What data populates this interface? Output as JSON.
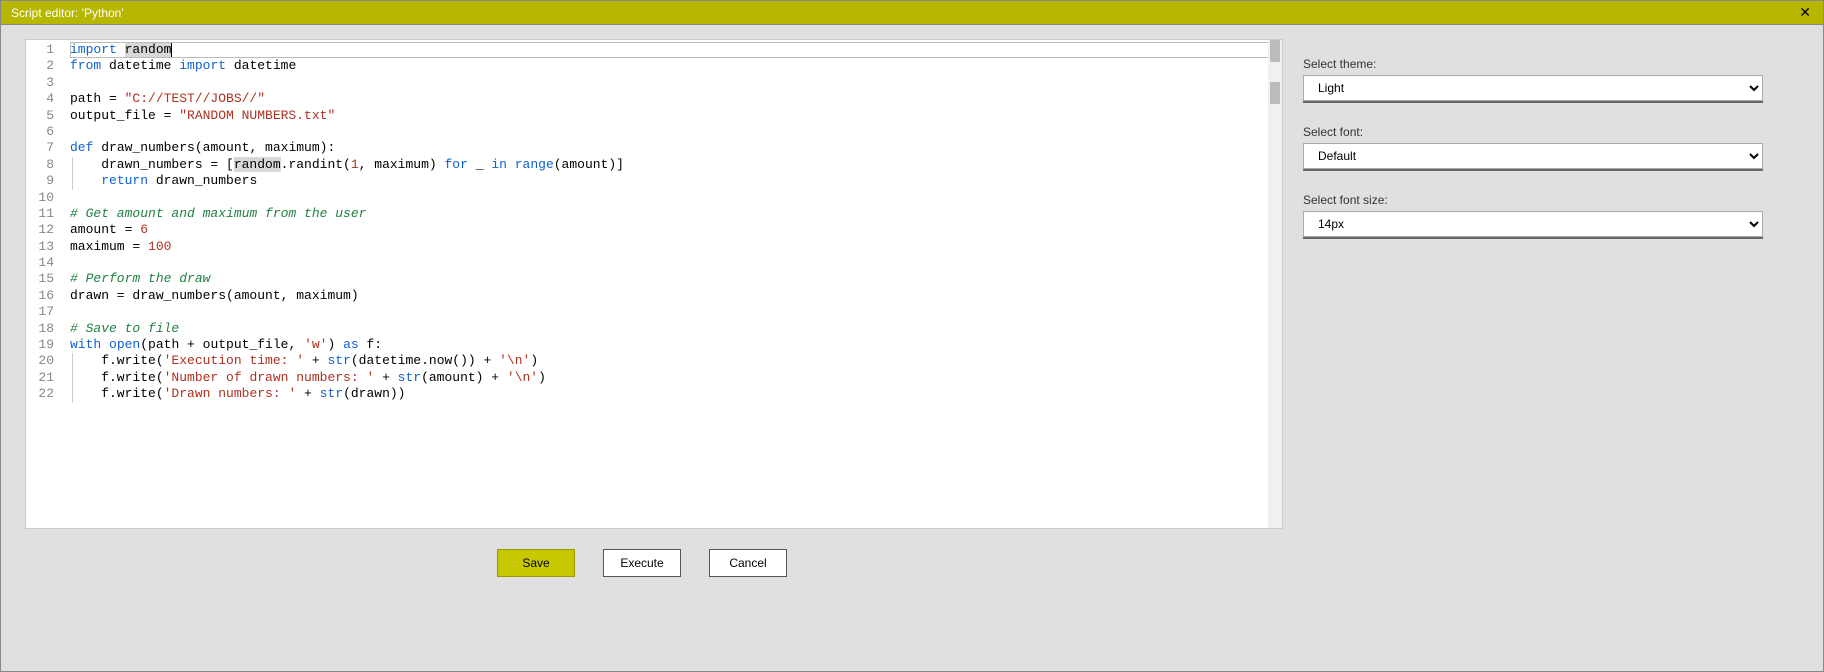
{
  "title": "Script editor: 'Python'",
  "code_lines": [
    {
      "n": 1,
      "tokens": [
        {
          "t": "import ",
          "c": "kw"
        },
        {
          "t": "random",
          "c": "hl"
        }
      ],
      "active": true
    },
    {
      "n": 2,
      "tokens": [
        {
          "t": "from ",
          "c": "kw"
        },
        {
          "t": "datetime ",
          "c": ""
        },
        {
          "t": "import ",
          "c": "kw"
        },
        {
          "t": "datetime",
          "c": ""
        }
      ]
    },
    {
      "n": 3,
      "tokens": []
    },
    {
      "n": 4,
      "tokens": [
        {
          "t": "path = ",
          "c": ""
        },
        {
          "t": "\"C://TEST//JOBS//\"",
          "c": "str"
        }
      ]
    },
    {
      "n": 5,
      "tokens": [
        {
          "t": "output_file = ",
          "c": ""
        },
        {
          "t": "\"RANDOM NUMBERS.txt\"",
          "c": "str"
        }
      ]
    },
    {
      "n": 6,
      "tokens": []
    },
    {
      "n": 7,
      "tokens": [
        {
          "t": "def ",
          "c": "def"
        },
        {
          "t": "draw_numbers",
          "c": "fn"
        },
        {
          "t": "(amount, maximum):",
          "c": ""
        }
      ]
    },
    {
      "n": 8,
      "indent": 1,
      "tokens": [
        {
          "t": "    drawn_numbers = [",
          "c": ""
        },
        {
          "t": "random",
          "c": "hl"
        },
        {
          "t": ".randint(",
          "c": ""
        },
        {
          "t": "1",
          "c": "num"
        },
        {
          "t": ", maximum) ",
          "c": ""
        },
        {
          "t": "for ",
          "c": "kw"
        },
        {
          "t": "_ ",
          "c": ""
        },
        {
          "t": "in ",
          "c": "kw"
        },
        {
          "t": "range",
          "c": "builtin"
        },
        {
          "t": "(amount)]",
          "c": ""
        }
      ]
    },
    {
      "n": 9,
      "indent": 1,
      "tokens": [
        {
          "t": "    ",
          "c": ""
        },
        {
          "t": "return ",
          "c": "kw"
        },
        {
          "t": "drawn_numbers",
          "c": ""
        }
      ]
    },
    {
      "n": 10,
      "tokens": []
    },
    {
      "n": 11,
      "tokens": [
        {
          "t": "# Get amount and maximum from the user",
          "c": "cmt"
        }
      ]
    },
    {
      "n": 12,
      "tokens": [
        {
          "t": "amount = ",
          "c": ""
        },
        {
          "t": "6",
          "c": "num"
        }
      ]
    },
    {
      "n": 13,
      "tokens": [
        {
          "t": "maximum = ",
          "c": ""
        },
        {
          "t": "100",
          "c": "num"
        }
      ]
    },
    {
      "n": 14,
      "tokens": []
    },
    {
      "n": 15,
      "tokens": [
        {
          "t": "# Perform the draw",
          "c": "cmt"
        }
      ]
    },
    {
      "n": 16,
      "tokens": [
        {
          "t": "drawn = draw_numbers(amount, maximum)",
          "c": ""
        }
      ]
    },
    {
      "n": 17,
      "tokens": []
    },
    {
      "n": 18,
      "tokens": [
        {
          "t": "# Save to file",
          "c": "cmt"
        }
      ]
    },
    {
      "n": 19,
      "tokens": [
        {
          "t": "with ",
          "c": "kw"
        },
        {
          "t": "open",
          "c": "builtin"
        },
        {
          "t": "(path + output_file, ",
          "c": ""
        },
        {
          "t": "'w'",
          "c": "str"
        },
        {
          "t": ") ",
          "c": ""
        },
        {
          "t": "as ",
          "c": "kw"
        },
        {
          "t": "f:",
          "c": ""
        }
      ]
    },
    {
      "n": 20,
      "indent": 1,
      "tokens": [
        {
          "t": "    f.write(",
          "c": ""
        },
        {
          "t": "'Execution time: '",
          "c": "str"
        },
        {
          "t": " + ",
          "c": ""
        },
        {
          "t": "str",
          "c": "builtin"
        },
        {
          "t": "(datetime.now()) + ",
          "c": ""
        },
        {
          "t": "'\\n'",
          "c": "str"
        },
        {
          "t": ")",
          "c": ""
        }
      ]
    },
    {
      "n": 21,
      "indent": 1,
      "tokens": [
        {
          "t": "    f.write(",
          "c": ""
        },
        {
          "t": "'Number of drawn numbers: '",
          "c": "str"
        },
        {
          "t": " + ",
          "c": ""
        },
        {
          "t": "str",
          "c": "builtin"
        },
        {
          "t": "(amount) + ",
          "c": ""
        },
        {
          "t": "'\\n'",
          "c": "str"
        },
        {
          "t": ")",
          "c": ""
        }
      ]
    },
    {
      "n": 22,
      "indent": 1,
      "tokens": [
        {
          "t": "    f.write(",
          "c": ""
        },
        {
          "t": "'Drawn numbers: '",
          "c": "str"
        },
        {
          "t": " + ",
          "c": ""
        },
        {
          "t": "str",
          "c": "builtin"
        },
        {
          "t": "(drawn))",
          "c": ""
        }
      ]
    }
  ],
  "buttons": {
    "save": "Save",
    "execute": "Execute",
    "cancel": "Cancel"
  },
  "sidebar": {
    "theme_label": "Select theme:",
    "theme_value": "Light",
    "font_label": "Select font:",
    "font_value": "Default",
    "fontsize_label": "Select font size:",
    "fontsize_value": "14px"
  }
}
